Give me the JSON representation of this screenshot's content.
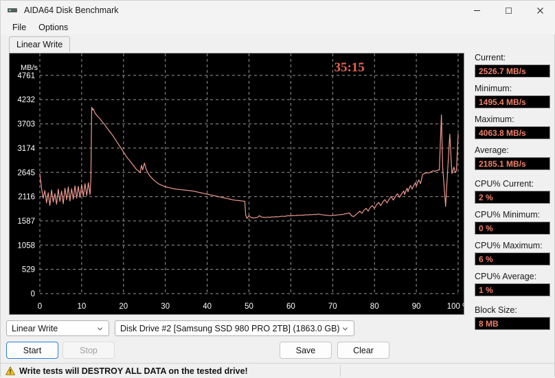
{
  "window": {
    "title": "AIDA64 Disk Benchmark",
    "icon": "disk-drive-icon",
    "controls": {
      "minimize": "—",
      "maximize": "□",
      "close": "✕"
    }
  },
  "menubar": {
    "items": [
      {
        "label": "File"
      },
      {
        "label": "Options"
      }
    ]
  },
  "tabs": [
    {
      "label": "Linear Write",
      "active": true
    }
  ],
  "chart_data": {
    "type": "line",
    "title": "",
    "timer": "35:15",
    "ylabel": "MB/s",
    "xlabel": "100 %",
    "xlim": [
      0,
      100
    ],
    "ylim": [
      0,
      5029
    ],
    "grid": true,
    "line_color": "#f09a90",
    "grid_color": "#9a9a9a",
    "tick_color": "#ffffff",
    "background": "#000000",
    "yticks": [
      0,
      529,
      1058,
      1587,
      2116,
      2645,
      3174,
      3703,
      4232,
      4761
    ],
    "xticks": [
      0,
      10,
      20,
      30,
      40,
      50,
      60,
      70,
      80,
      90,
      100
    ],
    "xtick_labels": [
      "0",
      "10",
      "20",
      "30",
      "40",
      "50",
      "60",
      "70",
      "80",
      "90",
      "100 %"
    ],
    "series": [
      {
        "name": "Linear Write",
        "x": [
          0,
          0.4,
          0.8,
          1.2,
          1.6,
          2,
          2.4,
          2.8,
          3.2,
          3.6,
          4,
          4.4,
          4.8,
          5.2,
          5.6,
          6,
          6.4,
          6.8,
          7.2,
          7.6,
          8,
          8.4,
          8.8,
          9.2,
          9.6,
          10,
          10.4,
          10.8,
          11.2,
          11.6,
          12,
          12.2,
          12.4,
          12.5,
          12.6,
          12.8,
          13,
          13.2,
          13.5,
          14,
          14.5,
          15,
          15.5,
          16,
          16.5,
          17,
          17.5,
          18,
          18.5,
          19,
          19.5,
          20,
          20.5,
          21,
          21.5,
          22,
          22.5,
          23,
          23.5,
          24,
          24.3,
          24.6,
          25,
          25.4,
          25.8,
          26.2,
          26.6,
          27,
          27.5,
          28,
          28.5,
          29,
          29.5,
          30,
          30.5,
          31,
          31.5,
          32,
          32.5,
          33,
          33.5,
          34,
          34.5,
          35,
          35.5,
          36,
          36.5,
          37,
          37.5,
          38,
          38.5,
          39,
          39.5,
          40,
          40.5,
          41,
          41.5,
          42,
          42.5,
          43,
          43.5,
          44,
          44.5,
          45,
          45.5,
          46,
          46.5,
          47,
          47.5,
          48,
          48.5,
          48.8,
          49,
          49.2,
          49.5,
          50,
          50.5,
          51,
          51.5,
          52,
          52.5,
          53,
          53.5,
          54,
          54.5,
          55,
          55.5,
          56,
          56.5,
          57,
          57.5,
          58,
          58.5,
          59,
          59.5,
          60,
          60.5,
          61,
          61.5,
          62,
          62.5,
          63,
          63.5,
          64,
          64.5,
          65,
          65.5,
          66,
          66.5,
          67,
          67.5,
          68,
          68.5,
          69,
          69.5,
          70,
          70.5,
          71,
          71.5,
          72,
          72.5,
          73,
          73.5,
          74,
          74.5,
          75,
          75.5,
          76,
          76.5,
          77,
          77.5,
          78,
          78.5,
          79,
          79.5,
          80,
          80.5,
          81,
          81.5,
          82,
          82.5,
          83,
          83.5,
          84,
          84.5,
          85,
          85.5,
          86,
          86.5,
          87,
          87.2,
          87.5,
          87.8,
          88,
          88.3,
          88.6,
          89,
          89.4,
          89.8,
          90,
          90.3,
          90.6,
          91,
          91.5,
          92,
          92.5,
          93,
          93.3,
          93.6,
          94,
          94.5,
          95,
          95.5,
          96,
          96.3,
          96.6,
          97,
          97.5,
          98,
          98.5,
          99,
          99.3,
          99.6,
          100
        ],
        "y": [
          2620,
          2300,
          2080,
          2250,
          1980,
          2200,
          1920,
          2260,
          2000,
          2180,
          1950,
          2280,
          2010,
          2240,
          1960,
          2300,
          2050,
          2330,
          2020,
          2290,
          2060,
          2350,
          2080,
          2340,
          2100,
          2380,
          2120,
          2400,
          2140,
          2420,
          2160,
          2500,
          4063,
          4050,
          4010,
          4030,
          3980,
          3940,
          3900,
          3850,
          3800,
          3740,
          3690,
          3620,
          3560,
          3500,
          3440,
          3370,
          3300,
          3230,
          3160,
          3090,
          3020,
          2950,
          2900,
          2840,
          2780,
          2720,
          2680,
          2640,
          2800,
          2700,
          2850,
          2720,
          2640,
          2580,
          2540,
          2500,
          2460,
          2420,
          2390,
          2370,
          2350,
          2330,
          2320,
          2310,
          2300,
          2290,
          2280,
          2275,
          2270,
          2265,
          2260,
          2255,
          2250,
          2245,
          2240,
          2230,
          2220,
          2210,
          2200,
          2190,
          2180,
          2170,
          2160,
          2150,
          2140,
          2130,
          2120,
          2110,
          2100,
          2090,
          2080,
          2070,
          2060,
          2050,
          2040,
          2035,
          2030,
          2025,
          2020,
          2015,
          2010,
          1720,
          1640,
          1700,
          1660,
          1650,
          1655,
          1660,
          1700,
          1670,
          1665,
          1660,
          1670,
          1665,
          1675,
          1670,
          1680,
          1675,
          1685,
          1690,
          1685,
          1695,
          1700,
          1695,
          1705,
          1700,
          1710,
          1705,
          1715,
          1710,
          1720,
          1715,
          1725,
          1720,
          1730,
          1725,
          1735,
          1730,
          1720,
          1715,
          1710,
          1705,
          1700,
          1705,
          1710,
          1715,
          1720,
          1725,
          1730,
          1740,
          1750,
          1760,
          1700,
          1680,
          1720,
          1760,
          1800,
          1750,
          1820,
          1860,
          1800,
          1880,
          1920,
          1860,
          1940,
          1990,
          1920,
          2000,
          2050,
          1980,
          2060,
          2120,
          2040,
          2120,
          2180,
          2100,
          2180,
          2240,
          2160,
          2240,
          2300,
          2220,
          2300,
          2360,
          2280,
          2360,
          2420,
          2340,
          2420,
          2480,
          2400,
          2600,
          2620,
          2640,
          2630,
          2650,
          2660,
          2680,
          2670,
          2690,
          2700,
          3900,
          2750,
          2400,
          1900,
          2700,
          3480,
          2620,
          2760,
          2640,
          2680,
          3490,
          2700,
          2730,
          2620,
          2650,
          2380,
          2640,
          2700,
          2720,
          2640,
          2690,
          2660,
          3540,
          2680,
          2560,
          2700
        ]
      }
    ]
  },
  "stats": [
    {
      "id": "current",
      "label": "Current:",
      "value": "2526.7 MB/s"
    },
    {
      "id": "minimum",
      "label": "Minimum:",
      "value": "1495.4 MB/s"
    },
    {
      "id": "maximum",
      "label": "Maximum:",
      "value": "4063.8 MB/s"
    },
    {
      "id": "average",
      "label": "Average:",
      "value": "2185.1 MB/s"
    },
    {
      "id": "cpu_current",
      "label": "CPU% Current:",
      "value": "2 %"
    },
    {
      "id": "cpu_minimum",
      "label": "CPU% Minimum:",
      "value": "0 %"
    },
    {
      "id": "cpu_maximum",
      "label": "CPU% Maximum:",
      "value": "6 %"
    },
    {
      "id": "cpu_average",
      "label": "CPU% Average:",
      "value": "1 %"
    },
    {
      "id": "block_size",
      "label": "Block Size:",
      "value": "8 MB"
    }
  ],
  "controls": {
    "mode_combo": {
      "value": "Linear Write"
    },
    "drive_combo": {
      "value": "Disk Drive #2  [Samsung SSD 980 PRO 2TB]  (1863.0 GB)"
    },
    "start_button": "Start",
    "stop_button": "Stop",
    "save_button": "Save",
    "clear_button": "Clear"
  },
  "statusbar": {
    "warning": "Write tests will DESTROY ALL DATA on the tested drive!"
  }
}
